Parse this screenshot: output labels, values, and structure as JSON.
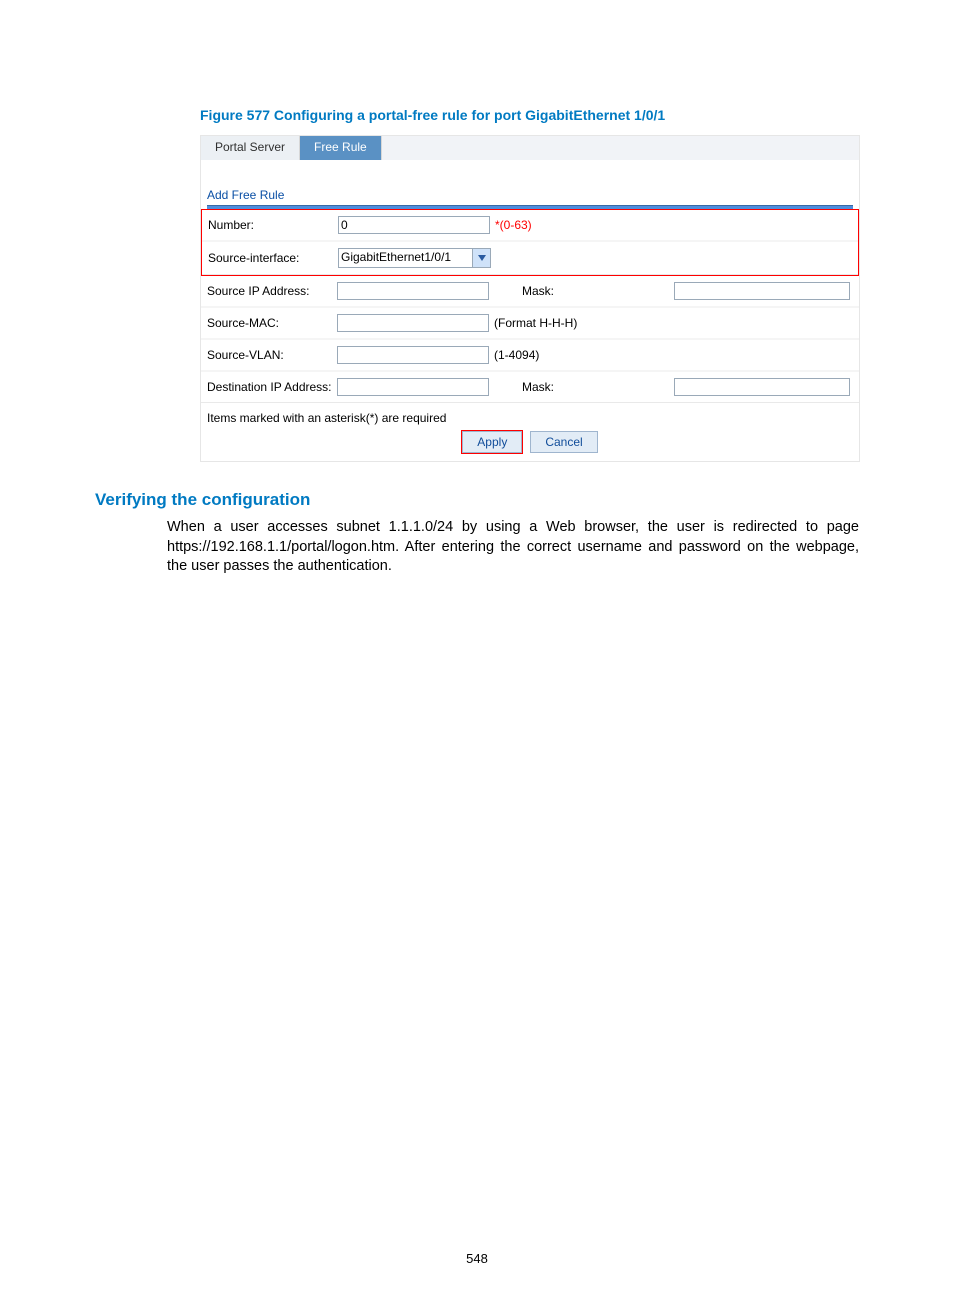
{
  "figure_caption": "Figure 577 Configuring a portal-free rule for port GigabitEthernet 1/0/1",
  "tabs": {
    "portal_server": "Portal Server",
    "free_rule": "Free Rule"
  },
  "section": {
    "add_free_rule": "Add Free Rule"
  },
  "form": {
    "number": {
      "label": "Number:",
      "value": "0",
      "range": "*(0-63)"
    },
    "source_interface": {
      "label": "Source-interface:",
      "value": "GigabitEthernet1/0/1"
    },
    "source_ip": {
      "label": "Source IP Address:",
      "value": "",
      "mask_label": "Mask:",
      "mask_value": ""
    },
    "source_mac": {
      "label": "Source-MAC:",
      "value": "",
      "format": "(Format H-H-H)"
    },
    "source_vlan": {
      "label": "Source-VLAN:",
      "value": "",
      "range": "(1-4094)"
    },
    "dest_ip": {
      "label": "Destination IP Address:",
      "value": "",
      "mask_label": "Mask:",
      "mask_value": ""
    }
  },
  "required_note": "Items marked with an asterisk(*) are required",
  "buttons": {
    "apply": "Apply",
    "cancel": "Cancel"
  },
  "heading": "Verifying the configuration",
  "paragraph": "When a user accesses subnet 1.1.1.0/24 by using a Web browser, the user is redirected to page https://192.168.1.1/portal/logon.htm. After entering the correct username and password on the webpage, the user passes the authentication.",
  "page_number": "548"
}
